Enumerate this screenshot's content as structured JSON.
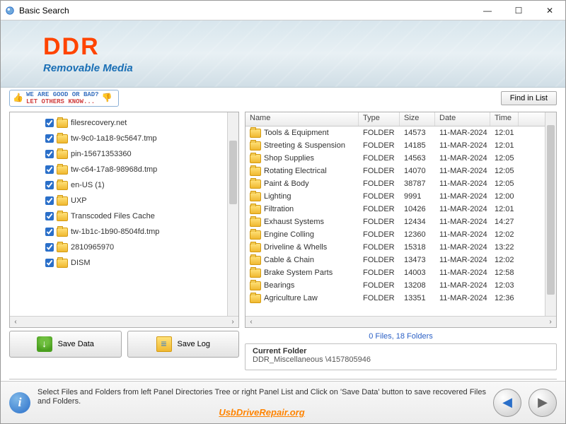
{
  "window": {
    "title": "Basic Search"
  },
  "banner": {
    "brand": "DDR",
    "subtitle": "Removable Media"
  },
  "feedback": {
    "line1": "WE ARE GOOD OR BAD?",
    "line2": "LET OTHERS KNOW..."
  },
  "buttons": {
    "find_in_list": "Find in List",
    "save_data": "Save Data",
    "save_log": "Save Log"
  },
  "tree": {
    "items": [
      {
        "label": "filesrecovery.net"
      },
      {
        "label": "tw-9c0-1a18-9c5647.tmp"
      },
      {
        "label": "pin-15671353360"
      },
      {
        "label": "tw-c64-17a8-98968d.tmp"
      },
      {
        "label": "en-US (1)"
      },
      {
        "label": "UXP"
      },
      {
        "label": "Transcoded Files Cache"
      },
      {
        "label": "tw-1b1c-1b90-8504fd.tmp"
      },
      {
        "label": "2810965970"
      },
      {
        "label": "DISM"
      }
    ]
  },
  "grid": {
    "columns": {
      "name": "Name",
      "type": "Type",
      "size": "Size",
      "date": "Date",
      "time": "Time"
    },
    "rows": [
      {
        "name": "Tools & Equipment",
        "type": "FOLDER",
        "size": "14573",
        "date": "11-MAR-2024",
        "time": "12:01"
      },
      {
        "name": "Streeting & Suspension",
        "type": "FOLDER",
        "size": "14185",
        "date": "11-MAR-2024",
        "time": "12:01"
      },
      {
        "name": "Shop Supplies",
        "type": "FOLDER",
        "size": "14563",
        "date": "11-MAR-2024",
        "time": "12:05"
      },
      {
        "name": "Rotating Electrical",
        "type": "FOLDER",
        "size": "14070",
        "date": "11-MAR-2024",
        "time": "12:05"
      },
      {
        "name": "Paint & Body",
        "type": "FOLDER",
        "size": "38787",
        "date": "11-MAR-2024",
        "time": "12:05"
      },
      {
        "name": "Lighting",
        "type": "FOLDER",
        "size": "9991",
        "date": "11-MAR-2024",
        "time": "12:00"
      },
      {
        "name": "Filtration",
        "type": "FOLDER",
        "size": "10426",
        "date": "11-MAR-2024",
        "time": "12:01"
      },
      {
        "name": "Exhaust Systems",
        "type": "FOLDER",
        "size": "12434",
        "date": "11-MAR-2024",
        "time": "14:27"
      },
      {
        "name": "Engine Colling",
        "type": "FOLDER",
        "size": "12360",
        "date": "11-MAR-2024",
        "time": "12:02"
      },
      {
        "name": "Driveline & Whells",
        "type": "FOLDER",
        "size": "15318",
        "date": "11-MAR-2024",
        "time": "13:22"
      },
      {
        "name": "Cable & Chain",
        "type": "FOLDER",
        "size": "13473",
        "date": "11-MAR-2024",
        "time": "12:02"
      },
      {
        "name": "Brake System Parts",
        "type": "FOLDER",
        "size": "14003",
        "date": "11-MAR-2024",
        "time": "12:58"
      },
      {
        "name": "Bearings",
        "type": "FOLDER",
        "size": "13208",
        "date": "11-MAR-2024",
        "time": "12:03"
      },
      {
        "name": "Agriculture Law",
        "type": "FOLDER",
        "size": "13351",
        "date": "11-MAR-2024",
        "time": "12:36"
      }
    ]
  },
  "status": {
    "counts": "0 Files, 18 Folders"
  },
  "current_folder": {
    "title": "Current Folder",
    "path": "DDR_Miscellaneous \\4157805946"
  },
  "footer": {
    "hint": "Select Files and Folders from left Panel Directories Tree or right Panel List and Click on 'Save Data' button to save recovered Files and Folders.",
    "site": "UsbDriveRepair.org"
  }
}
